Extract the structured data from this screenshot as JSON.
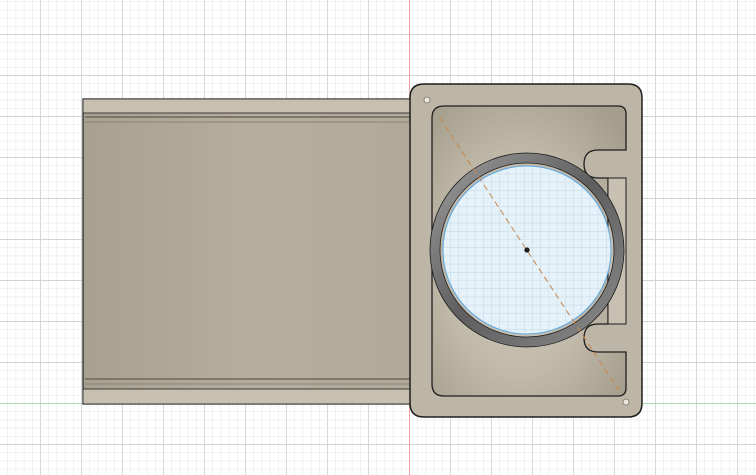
{
  "viewport": {
    "view": "top",
    "background": "#ffffff",
    "grid": {
      "visible": true,
      "minor_color": "#e6e9ec",
      "major_color": "#cfd4d8"
    },
    "axes": {
      "vertical_axis_color": "#e8a0a0",
      "horizontal_axis_color": "#a8dca8"
    }
  },
  "model": {
    "body_color": "#b6ad9c",
    "body_dark": "#9c9483",
    "body_light": "#cbc3b4",
    "edge_color": "#1e1e1e",
    "glass_color": "#e6f2fa",
    "selection_color": "#5aa9e6",
    "construction_line_color": "#c8864a",
    "components": [
      "rectangular-channel",
      "clip-housing",
      "ring-seal",
      "lens-opening"
    ]
  }
}
